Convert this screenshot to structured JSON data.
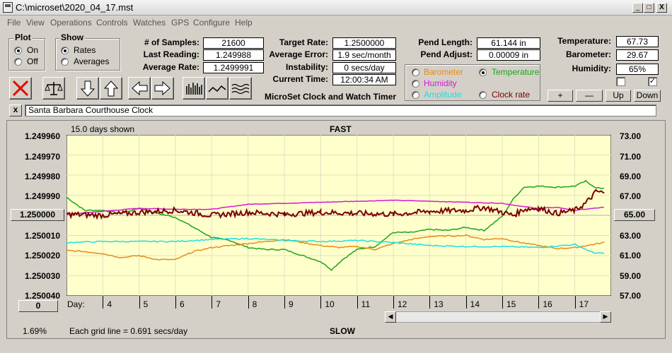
{
  "window": {
    "title": "C:\\microset\\2020_04_17.mst",
    "minimize": "_",
    "restore": "□",
    "close": "X"
  },
  "menu": [
    "File",
    "View",
    "Operations",
    "Controls",
    "Watches",
    "GPS",
    "Configure",
    "Help"
  ],
  "plot_group": {
    "label": "Plot",
    "on": "On",
    "off": "Off",
    "selected": "On"
  },
  "show_group": {
    "label": "Show",
    "rates": "Rates",
    "averages": "Averages",
    "selected": "Rates"
  },
  "stats": {
    "samples_label": "# of Samples:",
    "samples": "21600",
    "last_label": "Last Reading:",
    "last": "1.249988",
    "avg_label": "Average Rate:",
    "avg": "1.2499991",
    "target_label": "Target Rate:",
    "target": "1.2500000",
    "avgerr_label": "Average Error:",
    "avgerr": "1.9 sec/month",
    "instab_label": "Instability:",
    "instab": "0 secs/day",
    "time_label": "Current Time:",
    "time": "12:00:34 AM",
    "pendlen_label": "Pend Length:",
    "pendlen": "61.144 in",
    "pendadj_label": "Pend Adjust:",
    "pendadj": "0.00009 in",
    "temp_label": "Temperature:",
    "temp": "67.73",
    "baro_label": "Barometer:",
    "baro": "29.67",
    "hum_label": "Humidity:",
    "hum": "65%"
  },
  "app_caption": "MicroSet Clock and Watch Timer",
  "channels": {
    "barometer": {
      "label": "Barometer",
      "color": "#e88a1a"
    },
    "temperature": {
      "label": "Temperature",
      "color": "#1aa51a"
    },
    "humidity": {
      "label": "Humidity",
      "color": "#d41ad4"
    },
    "amplitude": {
      "label": "Amplitude",
      "color": "#1ae0e0"
    },
    "clockrate": {
      "label": "Clock rate",
      "color": "#7a0000"
    },
    "selected": "Temperature"
  },
  "adjust_buttons": {
    "plus": "+",
    "minus": "—",
    "up": "Up",
    "down": "Down"
  },
  "checkbox2_mark": "✓",
  "toolbar_icons": [
    "cancel-icon",
    "balance-icon",
    "arrow-down-icon",
    "arrow-up-icon",
    "arrow-left-icon",
    "arrow-right-icon",
    "bar-graph-icon",
    "line-graph-icon",
    "wave-graph-icon"
  ],
  "watch_close": "x",
  "watch_name": "Santa Barbara Courthouse Clock",
  "chart_header": {
    "days_shown": "15.0 days shown",
    "fast": "FAST",
    "slow": "SLOW",
    "grid_note": "Each grid line = 0.691 secs/day",
    "percent": "1.69%",
    "day_label": "Day:",
    "left_value_box": "1.250000",
    "right_value_box": "65.00",
    "zero_box": "0"
  },
  "chart_data": {
    "type": "line",
    "y_left_ticks": [
      "1.249960",
      "1.249970",
      "1.249980",
      "1.249990",
      "1.250000",
      "1.250010",
      "1.250020",
      "1.250030",
      "1.250040"
    ],
    "y_right_ticks": [
      "73.00",
      "71.00",
      "69.00",
      "67.00",
      "65.00",
      "63.00",
      "61.00",
      "59.00",
      "57.00"
    ],
    "x_ticks": [
      "4",
      "5",
      "6",
      "7",
      "8",
      "9",
      "10",
      "11",
      "12",
      "13",
      "14",
      "15",
      "16",
      "17"
    ],
    "x_range": [
      3,
      18
    ],
    "y_right_range": [
      57,
      73
    ],
    "series": [
      {
        "name": "Temperature",
        "color": "#1aa51a",
        "x": [
          3,
          3.5,
          4,
          4.5,
          5,
          5.5,
          6,
          6.5,
          7,
          7.5,
          8,
          8.5,
          9,
          9.5,
          10,
          10.3,
          10.6,
          11,
          11.5,
          12,
          12.5,
          13,
          13.5,
          14,
          14.5,
          15,
          15.3,
          15.6,
          16,
          16.5,
          17,
          17.3,
          17.6,
          17.8
        ],
        "y": [
          66.8,
          65.5,
          65.5,
          65.2,
          65.7,
          65.2,
          64.8,
          63.8,
          62.8,
          62.5,
          61.8,
          61.6,
          61.6,
          61.0,
          60.4,
          59.6,
          60.6,
          61.6,
          61.9,
          63.3,
          63.3,
          63.6,
          63.5,
          63.8,
          63.5,
          64.9,
          66.6,
          67.8,
          67.9,
          67.8,
          67.9,
          68.4,
          67.7,
          67.7
        ]
      },
      {
        "name": "Humidity",
        "color": "#d41ad4",
        "x": [
          3,
          4,
          5,
          6,
          7,
          8,
          9,
          10,
          11,
          12,
          13,
          14,
          15,
          15.5,
          16,
          16.5,
          17,
          17.8
        ],
        "y": [
          65.1,
          65.4,
          65.7,
          65.6,
          65.6,
          66.1,
          66.2,
          66.3,
          66.4,
          66.5,
          66.4,
          66.3,
          66.2,
          65.9,
          65.7,
          65.8,
          65.5,
          65.8
        ]
      },
      {
        "name": "Barometer",
        "color": "#e88a1a",
        "x": [
          3,
          3.5,
          4,
          4.5,
          5,
          5.5,
          6,
          6.5,
          7,
          7.5,
          8,
          9,
          9.5,
          10,
          10.5,
          11,
          11.5,
          12,
          12.5,
          13,
          14,
          14.5,
          15,
          15.5,
          16,
          16.5,
          17,
          17.5,
          17.8
        ],
        "y": [
          61.5,
          61.4,
          61.2,
          60.8,
          61.0,
          60.6,
          60.6,
          61.4,
          61.8,
          62.0,
          62.2,
          62.6,
          62.3,
          62.0,
          61.8,
          61.9,
          61.6,
          62.2,
          62.6,
          62.9,
          63.0,
          62.6,
          62.7,
          62.3,
          62.0,
          61.7,
          61.8,
          62.1,
          62.3
        ]
      },
      {
        "name": "Amplitude",
        "color": "#1ae0e0",
        "x": [
          3,
          4,
          5,
          6,
          7,
          8,
          9,
          10,
          11,
          12,
          13,
          14,
          15,
          16,
          17,
          17.5,
          17.8
        ],
        "y": [
          62.3,
          62.4,
          62.4,
          62.4,
          62.6,
          62.7,
          62.5,
          62.4,
          62.5,
          62.3,
          62.0,
          61.9,
          61.9,
          61.8,
          62.1,
          61.3,
          61.2
        ]
      },
      {
        "name": "Clock rate",
        "color": "#7a0000",
        "x": [
          3,
          4,
          5,
          6,
          7,
          8,
          9,
          10,
          11,
          12,
          13,
          14,
          14.5,
          15,
          15.3,
          15.6,
          16,
          16.5,
          17,
          17.3,
          17.6,
          17.8
        ],
        "y": [
          65.1,
          65.0,
          65.3,
          65.5,
          65.0,
          65.3,
          65.1,
          65.3,
          65.2,
          65.1,
          65.4,
          65.5,
          65.8,
          65.3,
          65.0,
          65.6,
          65.7,
          65.2,
          65.5,
          66.2,
          67.4,
          67.2
        ]
      }
    ]
  }
}
